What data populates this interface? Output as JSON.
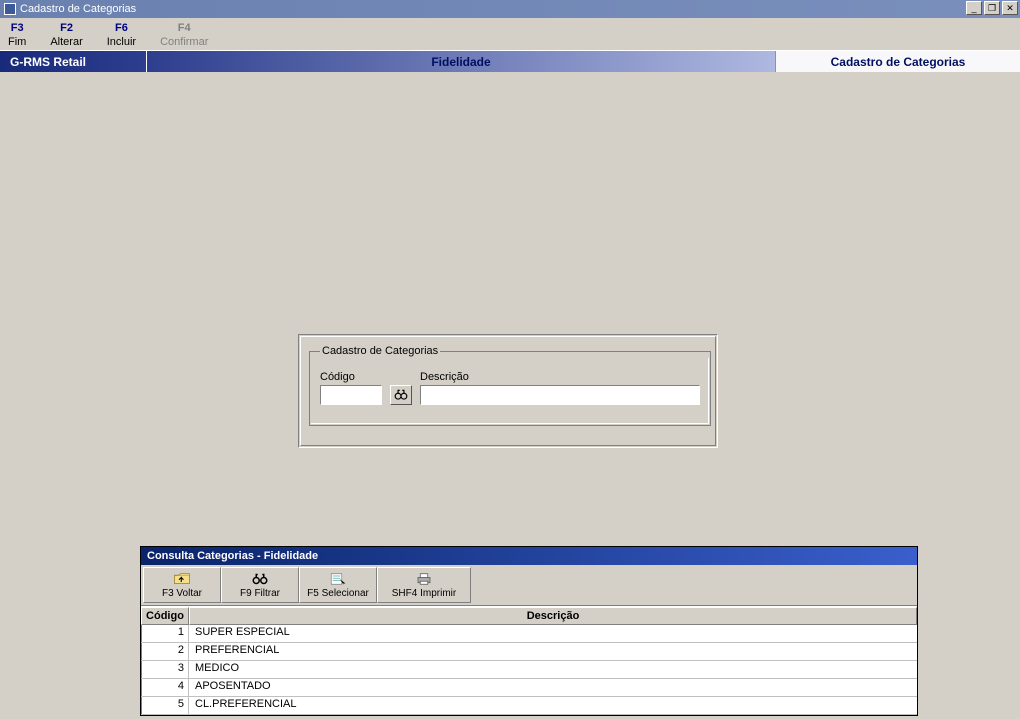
{
  "window": {
    "title": "Cadastro de Categorias",
    "controls": {
      "minimize": "_",
      "restore": "❐",
      "close": "✕"
    }
  },
  "fkeys": [
    {
      "key": "F3",
      "label": "Fim",
      "disabled": false
    },
    {
      "key": "F2",
      "label": "Alterar",
      "disabled": false
    },
    {
      "key": "F6",
      "label": "Incluir",
      "disabled": false
    },
    {
      "key": "F4",
      "label": "Confirmar",
      "disabled": true
    }
  ],
  "header": {
    "left": "G-RMS Retail",
    "mid": "Fidelidade",
    "right": "Cadastro de Categorias"
  },
  "form": {
    "legend": "Cadastro de Categorias",
    "codigo_label": "Código",
    "codigo_value": "",
    "descricao_label": "Descrição",
    "descricao_value": ""
  },
  "consulta": {
    "title": "Consulta Categorias - Fidelidade",
    "toolbar": [
      {
        "name": "voltar",
        "label": "F3 Voltar"
      },
      {
        "name": "filtrar",
        "label": "F9 Filtrar"
      },
      {
        "name": "selecionar",
        "label": "F5 Selecionar"
      },
      {
        "name": "imprimir",
        "label": "SHF4 Imprimir"
      }
    ],
    "columns": {
      "codigo": "Código",
      "descricao": "Descrição"
    },
    "rows": [
      {
        "codigo": "1",
        "descricao": "SUPER ESPECIAL"
      },
      {
        "codigo": "2",
        "descricao": "PREFERENCIAL"
      },
      {
        "codigo": "3",
        "descricao": "MEDICO"
      },
      {
        "codigo": "4",
        "descricao": "APOSENTADO"
      },
      {
        "codigo": "5",
        "descricao": "CL.PREFERENCIAL"
      }
    ]
  }
}
